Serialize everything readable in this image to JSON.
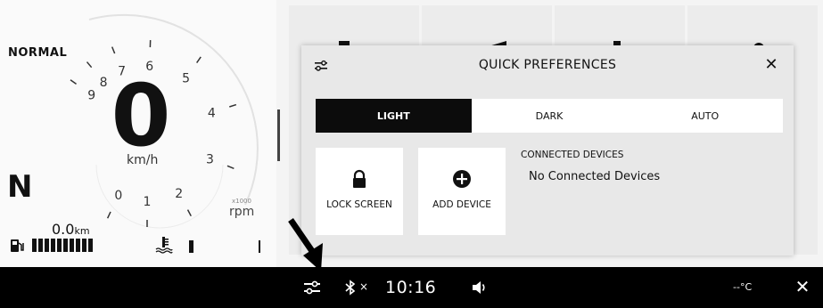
{
  "dashboard": {
    "mode": "NORMAL",
    "speed_value": "0",
    "speed_unit": "km/h",
    "gear": "N",
    "odometer_value": "0.0",
    "odometer_unit": "km",
    "rpm_multiplier": "x1000",
    "rpm_unit": "rpm",
    "rpm_ticks": [
      "0",
      "1",
      "2",
      "3",
      "4",
      "5",
      "6",
      "7",
      "8",
      "9"
    ],
    "fuel_level_bars": 10
  },
  "panel": {
    "title": "QUICK PREFERENCES",
    "close_glyph": "✕",
    "theme_tabs": [
      {
        "label": "LIGHT",
        "active": true
      },
      {
        "label": "DARK",
        "active": false
      },
      {
        "label": "AUTO",
        "active": false
      }
    ],
    "actions": {
      "lock_label": "LOCK SCREEN",
      "add_label": "ADD DEVICE"
    },
    "devices_title": "CONNECTED DEVICES",
    "devices_status": "No Connected Devices"
  },
  "statusbar": {
    "bluetooth_off_glyph": "×",
    "time": "10:16",
    "temperature": "--°C",
    "close_glyph": "✕"
  },
  "icons": {
    "panel_icon": "preferences-icon",
    "lock": "lock-icon",
    "add": "plus-circle-icon",
    "bluetooth": "bluetooth-icon",
    "volume": "volume-icon",
    "fuel": "fuel-pump-icon",
    "temperature": "coolant-temperature-icon"
  },
  "colors": {
    "active_tab_bg": "#0c0c0c",
    "statusbar_bg": "#000000",
    "panel_bg": "#e8e8e8"
  }
}
